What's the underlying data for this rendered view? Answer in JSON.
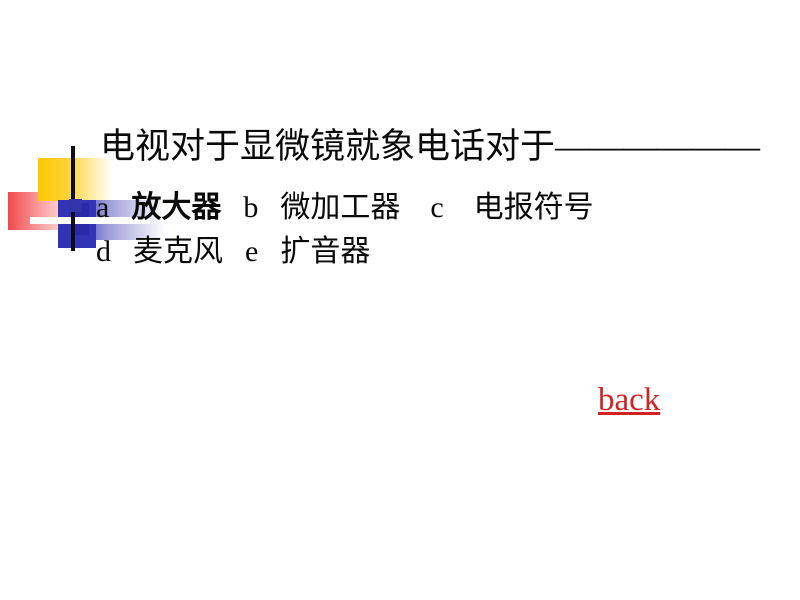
{
  "slide": {
    "background_color": "#ffffff",
    "title": {
      "text": "电视对于显微镜就象电话对于",
      "trailing_dashes": "——————"
    },
    "options_line_1": {
      "letter_a": "a",
      "answer_a": "放大器",
      "letter_b": "b",
      "answer_b": "微加工器",
      "letter_c": "c",
      "answer_c": "电报符号"
    },
    "options_line_2": {
      "letter_d": "d",
      "answer_d": "麦克风",
      "letter_e": "e",
      "answer_e": "扩音器"
    },
    "back_link": {
      "label": "back",
      "color": "#d42222"
    },
    "decoration": {
      "red_block_color": "#f04a4a",
      "yellow_block_color": "#fdc800",
      "blue_block_color": "#3333b5",
      "blue_band_color": "#3b3bbe",
      "vertical_line_color": "#0d0d14",
      "white_line_color": "#ffffff",
      "bullet_marker_color": "#3333aa"
    }
  }
}
